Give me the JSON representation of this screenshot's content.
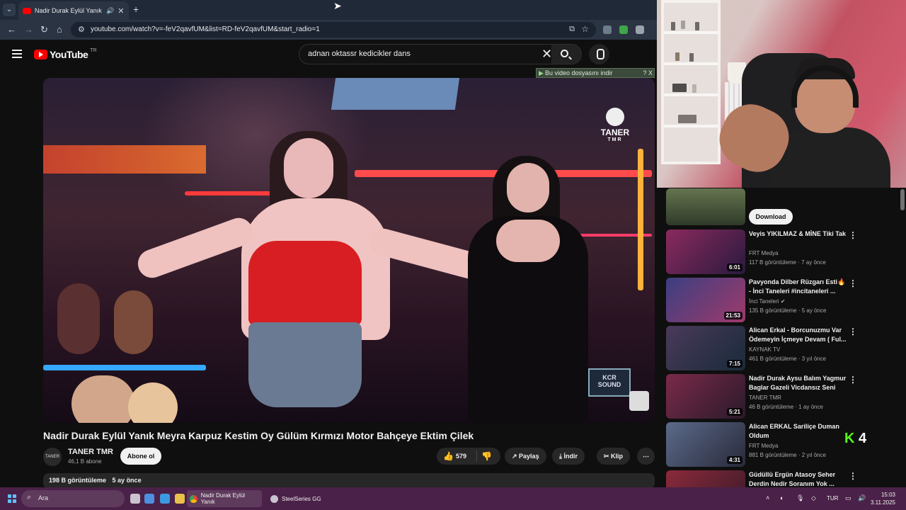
{
  "browser": {
    "tab_title": "Nadir Durak Eylül Yanık Me",
    "url": "youtube.com/watch?v=-feV2qavfUM&list=RD-feV2qavfUM&start_radio=1",
    "new_tab_symbol": "+"
  },
  "youtube": {
    "logo_text": "YouTube",
    "country_code": "TR",
    "search_query": "adnan oktassr kedicikler dans",
    "download_banner": "Bu video dosyasını indir",
    "download_banner_close": "? X",
    "watermark": {
      "name": "TANER",
      "sub": "TMR"
    },
    "video": {
      "title": "Nadir Durak Eylül Yanık Meyra Karpuz Kestim Oy Gülüm Kırmızı Motor Bahçeye Ektim Çilek",
      "channel": "TANER TMR",
      "channel_avatar_text": "TANER",
      "subscribers": "46,1 B abone",
      "subscribe_label": "Abone ol",
      "likes": "579",
      "share_label": "Paylaş",
      "download_label": "İndir",
      "clip_label": "Klip",
      "views": "198 B görüntüleme",
      "age": "5 ay önce"
    },
    "related_download_label": "Download",
    "related": [
      {
        "title": "Veyis YIKILMAZ & MİNE  Tiki Tak",
        "channel": "FRT Medya",
        "meta": "117 B görüntüleme · 7 ay önce",
        "duration": "6:01",
        "color": "#8a2a5e"
      },
      {
        "title": "Pavyonda Dilber Rüzgarı Esti🔥 - İnci Taneleri #incitaneleri ...",
        "channel": "İnci Taneleri ✔",
        "meta": "135 B görüntüleme · 5 ay önce",
        "duration": "21:53",
        "color": "#3b3f82"
      },
      {
        "title": "Alican Erkal - Borcunuzmu Var Ödemeyin İçmeye Devam ( Ful...",
        "channel": "KAYNAK TV",
        "meta": "461 B görüntüleme · 3 yıl önce",
        "duration": "7:15",
        "color": "#4a3a5a"
      },
      {
        "title": "Nadir Durak Aysu Balım Yagmur Baglar Gazeli Vicdansız Seni",
        "channel": "TANER TMR",
        "meta": "46 B görüntüleme · 1 ay önce",
        "duration": "5:21",
        "color": "#7a2a4a"
      },
      {
        "title": "Alican ERKAL Sariliçe Duman Oldum",
        "channel": "FRT Medya",
        "meta": "881 B görüntüleme · 2 yıl önce",
        "duration": "4:31",
        "color": "#5a6a8a"
      },
      {
        "title": "Güdüllü Ergün Atasoy Seher Derdin Nedir Soranım Yok ...",
        "channel": "",
        "meta": "",
        "duration": "",
        "color": "#8a2a3a"
      }
    ],
    "overlay_kick_number": "4"
  },
  "taskbar": {
    "search_placeholder": "Ara",
    "app_chrome": "Nadir Durak Eylül Yanık",
    "app_steelseries": "SteelSeries GG",
    "language": "TUR",
    "time": "15:03",
    "date": "3.11.2025"
  }
}
